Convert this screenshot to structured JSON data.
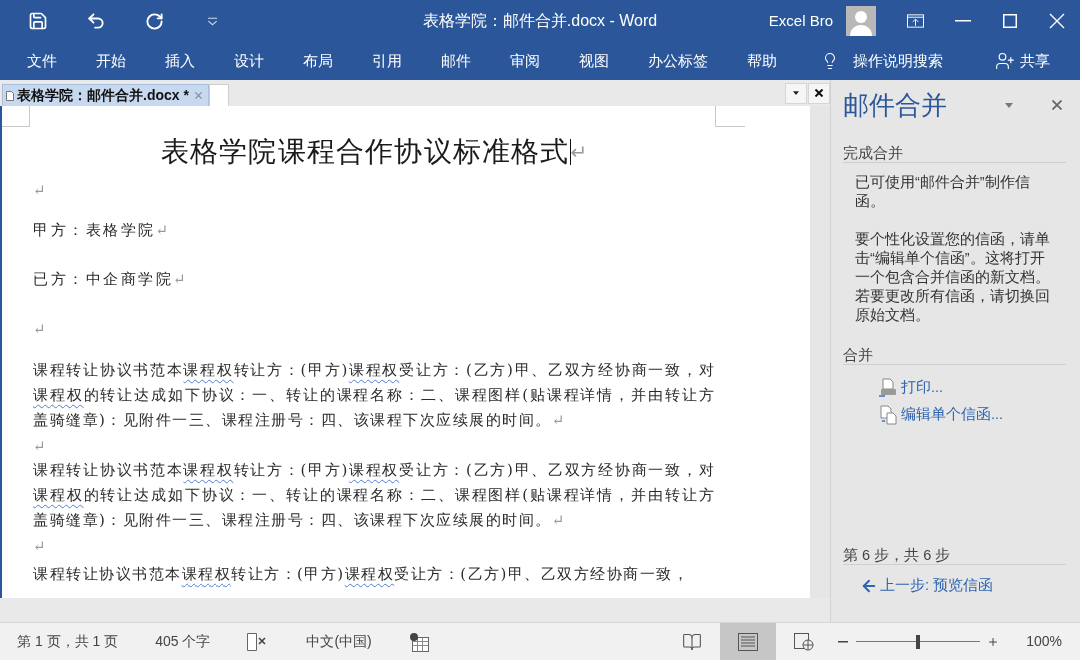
{
  "window": {
    "title": "表格学院：邮件合并.docx - Word",
    "user": "Excel Bro"
  },
  "ribbon": {
    "tabs": [
      {
        "label": "文件",
        "selected": false
      },
      {
        "label": "开始",
        "selected": false
      },
      {
        "label": "插入",
        "selected": false
      },
      {
        "label": "设计",
        "selected": false
      },
      {
        "label": "布局",
        "selected": false
      },
      {
        "label": "引用",
        "selected": false
      },
      {
        "label": "邮件",
        "selected": false
      },
      {
        "label": "审阅",
        "selected": false
      },
      {
        "label": "视图",
        "selected": false
      },
      {
        "label": "办公标签",
        "selected": false
      },
      {
        "label": "帮助",
        "selected": false
      }
    ],
    "tell_me": "操作说明搜索",
    "share": "共享"
  },
  "document_tabs": [
    {
      "label": "表格学院：邮件合并.docx *",
      "selected": true
    }
  ],
  "document": {
    "paragraphs": [
      {
        "kind": "title",
        "text": "表格学院课程合作协议标准格式",
        "mark": "↵",
        "cursor": true
      },
      {
        "kind": "empty",
        "mark": "↵",
        "cursor": false
      },
      {
        "kind": "party",
        "text": "甲方：表格学院",
        "mark": "↵",
        "cursor": false
      },
      {
        "kind": "party",
        "text": "已方：中企商学院",
        "mark": "↵",
        "cursor": false
      },
      {
        "kind": "empty",
        "mark": "↵",
        "cursor": false
      },
      {
        "kind": "body",
        "runs": [
          {
            "text": "课程转让协议书范本",
            "flagged": false
          },
          {
            "text": "课程权",
            "flagged": true
          },
          {
            "text": "转让方：(甲方)",
            "flagged": false
          },
          {
            "text": "课程权",
            "flagged": true
          },
          {
            "text": "受让方：(乙方)甲、乙双方经协商一致，对",
            "flagged": false
          },
          {
            "text": "课程权",
            "flagged": true
          },
          {
            "text": "的转让达成如下协议：一、转让的课程名称：二、课程图样(贴课程详情，并由转让方盖骑缝章)：见附件一三、课程注册号：四、该课程下次应续展的时间。",
            "flagged": false
          }
        ],
        "mark": "↵",
        "cursor": false
      },
      {
        "kind": "empty",
        "mark": "↵",
        "cursor": false
      },
      {
        "kind": "body",
        "runs": [
          {
            "text": "课程转让协议书范本",
            "flagged": false
          },
          {
            "text": "课程权",
            "flagged": true
          },
          {
            "text": "转让方：(甲方)",
            "flagged": false
          },
          {
            "text": "课程权",
            "flagged": true
          },
          {
            "text": "受让方：(乙方)甲、乙双方经协商一致，对",
            "flagged": false
          },
          {
            "text": "课程权",
            "flagged": true
          },
          {
            "text": "的转让达成如下协议：一、转让的课程名称：二、课程图样(贴课程详情，并由转让方盖骑缝章)：见附件一三、课程注册号：四、该课程下次应续展的时间。",
            "flagged": false
          }
        ],
        "mark": "↵",
        "cursor": false
      },
      {
        "kind": "empty",
        "mark": "↵",
        "cursor": false
      },
      {
        "kind": "body",
        "runs": [
          {
            "text": "课程转让协议书范本",
            "flagged": false
          },
          {
            "text": "课程权",
            "flagged": true
          },
          {
            "text": "转让方：(甲方)",
            "flagged": false
          },
          {
            "text": "课程权",
            "flagged": true
          },
          {
            "text": "受让方：(乙方)甲、乙双方经协商一致，",
            "flagged": false
          }
        ],
        "cursor": false
      }
    ]
  },
  "task_pane": {
    "title": "邮件合并",
    "sections": [
      {
        "heading": "完成合并",
        "paragraphs": [
          "已可使用“邮件合并”制作信函。",
          "要个性化设置您的信函，请单击“编辑单个信函”。这将打开一个包含合并信函的新文档。若要更改所有信函，请切换回原始文档。"
        ]
      },
      {
        "heading": "合并",
        "links": [
          {
            "kind": "print",
            "label": "打印..."
          },
          {
            "kind": "edit",
            "label": "编辑单个信函..."
          }
        ]
      }
    ],
    "step": "第 6 步，共 6 步",
    "back": "上一步: 预览信函"
  },
  "status_bar": {
    "page": "第 1 页，共 1 页",
    "words": "405 个字",
    "language": "中文(中国)",
    "views": [
      {
        "kind": "read",
        "selected": false
      },
      {
        "kind": "print",
        "selected": true
      },
      {
        "kind": "web",
        "selected": false
      }
    ],
    "zoom": {
      "level": 0.5,
      "reading": "100%"
    }
  }
}
